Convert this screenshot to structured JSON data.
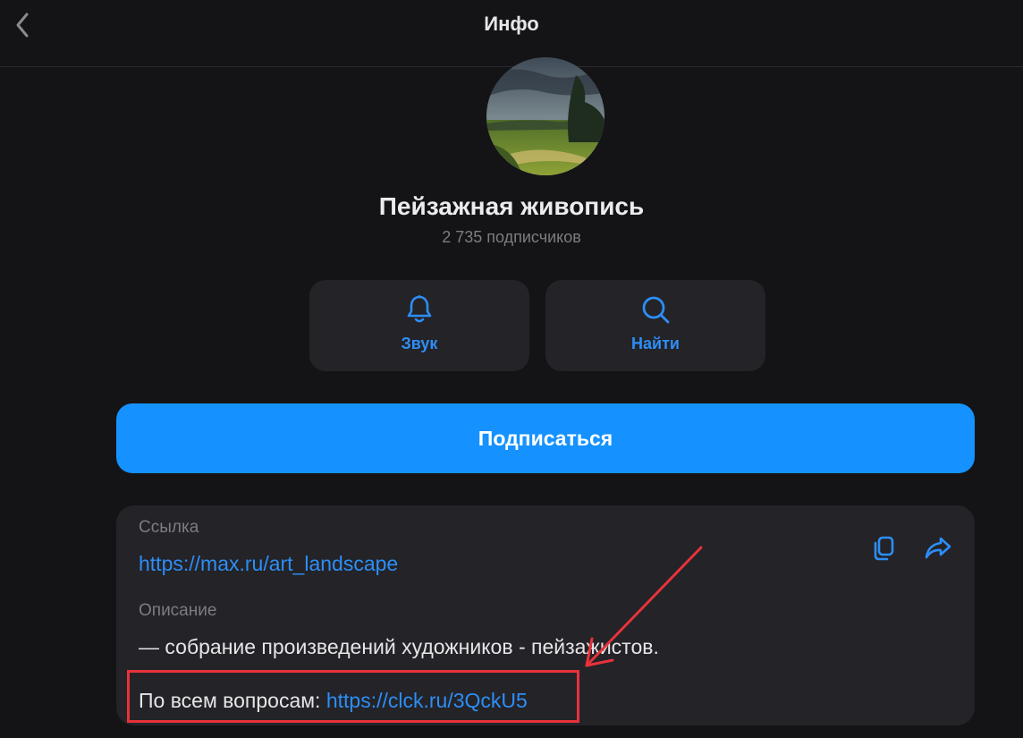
{
  "header": {
    "title": "Инфо"
  },
  "channel": {
    "name": "Пейзажная живопись",
    "subscribers": "2 735 подписчиков"
  },
  "actions": {
    "sound_label": "Звук",
    "find_label": "Найти"
  },
  "subscribe": {
    "label": "Подписаться"
  },
  "info": {
    "link_label": "Ссылка",
    "link_url": "https://max.ru/art_landscape",
    "description_label": "Описание",
    "description": "— собрание произведений художников - пейзажистов.",
    "contact_prefix": "По всем вопросам: ",
    "contact_url": "https://clck.ru/3QckU5"
  },
  "colors": {
    "background": "#141416",
    "card": "#232328",
    "accent": "#1592ff",
    "link": "#2d8ef5",
    "annotation": "#e8323a"
  },
  "icons": {
    "back": "chevron-left-icon",
    "sound": "bell-icon",
    "find": "search-icon",
    "copy": "copy-icon",
    "share": "share-icon"
  }
}
